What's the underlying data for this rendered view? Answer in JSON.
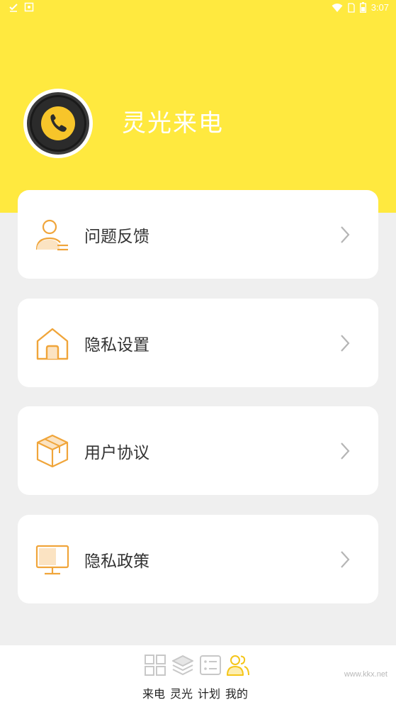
{
  "status_bar": {
    "time": "3:07",
    "left_icons": [
      "download-check-icon",
      "notification-icon"
    ],
    "right_icons": [
      "wifi-icon",
      "sim-icon",
      "battery-icon"
    ]
  },
  "profile": {
    "app_name": "灵光来电",
    "avatar_icon": "phone-icon"
  },
  "menu": {
    "items": [
      {
        "label": "问题反馈",
        "icon": "user-feedback-icon"
      },
      {
        "label": "隐私设置",
        "icon": "home-icon"
      },
      {
        "label": "用户协议",
        "icon": "box-icon"
      },
      {
        "label": "隐私政策",
        "icon": "monitor-icon"
      }
    ]
  },
  "tabbar": {
    "tabs": [
      {
        "label": "来电",
        "icon": "grid-icon"
      },
      {
        "label": "灵光",
        "icon": "layers-icon"
      },
      {
        "label": "计划",
        "icon": "list-icon"
      },
      {
        "label": "我的",
        "icon": "users-icon",
        "active": true
      }
    ]
  },
  "watermark": "www.kkx.net",
  "colors": {
    "header_bg": "#ffe93f",
    "accent_orange": "#f0a53a",
    "page_bg": "#efefef",
    "tab_active": "#f5c518",
    "tab_inactive": "#c8c8c8"
  }
}
